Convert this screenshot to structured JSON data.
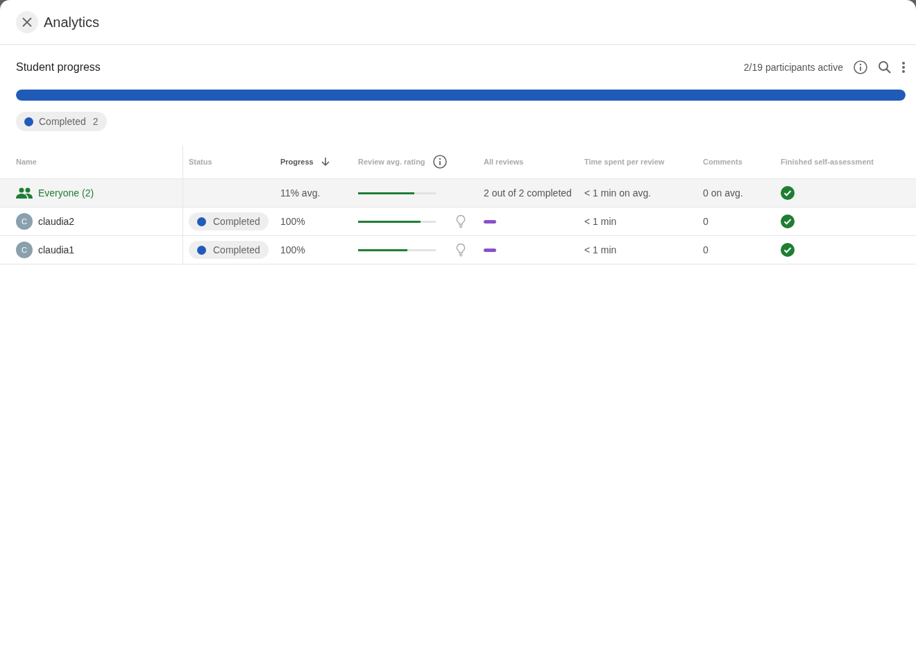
{
  "header": {
    "title": "Analytics"
  },
  "section": {
    "title": "Student progress",
    "participants": "2/19 participants active"
  },
  "overall_progress": {
    "level": 1.0,
    "color": "#215bb9"
  },
  "legend": [
    {
      "label": "Completed",
      "count": "2",
      "color": "#215bb9"
    }
  ],
  "table": {
    "columns": [
      {
        "label": "Name",
        "sorted": false,
        "info": false
      },
      {
        "label": "Status",
        "sorted": false,
        "info": false
      },
      {
        "label": "Progress",
        "sorted": true,
        "info": false
      },
      {
        "label": "Review avg. rating",
        "sorted": false,
        "info": true
      },
      {
        "label": "All reviews",
        "sorted": false,
        "info": false
      },
      {
        "label": "Time spent per review",
        "sorted": false,
        "info": false
      },
      {
        "label": "Comments",
        "sorted": false,
        "info": false
      },
      {
        "label": "Finished self-assessment",
        "sorted": false,
        "info": false
      }
    ],
    "rows": [
      {
        "kind": "group",
        "name": "Everyone (2)",
        "progress": "11% avg.",
        "rating": {
          "level": 0.72
        },
        "reviews": "2 out of 2 completed",
        "time": "< 1 min on avg.",
        "comments": "0 on avg.",
        "finished": true
      },
      {
        "kind": "student",
        "avatar": "C",
        "name": "claudia2",
        "status": {
          "label": "Completed",
          "color": "#215bb9"
        },
        "progress": "100%",
        "rating": {
          "level": 0.8
        },
        "time": "< 1 min",
        "comments": "0",
        "finished": true
      },
      {
        "kind": "student",
        "avatar": "C",
        "name": "claudia1",
        "status": {
          "label": "Completed",
          "color": "#215bb9"
        },
        "progress": "100%",
        "rating": {
          "level": 0.63
        },
        "time": "< 1 min",
        "comments": "0",
        "finished": true
      }
    ]
  }
}
